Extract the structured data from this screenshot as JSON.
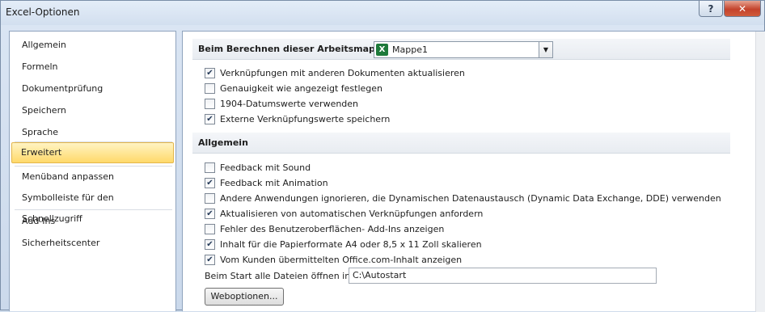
{
  "window": {
    "title": "Excel-Optionen"
  },
  "titlebar_buttons": {
    "help": "?",
    "close": "✕"
  },
  "sidebar": {
    "items": [
      {
        "label": "Allgemein"
      },
      {
        "label": "Formeln"
      },
      {
        "label": "Dokumentprüfung"
      },
      {
        "label": "Speichern"
      },
      {
        "label": "Sprache"
      },
      {
        "label": "Erweitert",
        "selected": true
      },
      {
        "label": "Menüband anpassen"
      },
      {
        "label": "Symbolleiste für den Schnellzugriff"
      },
      {
        "label": "Add-Ins"
      },
      {
        "label": "Sicherheitscenter"
      }
    ]
  },
  "section_calc": {
    "title": "Beim Berechnen dieser Arbeitsmappe:",
    "workbook_select": {
      "value": "Mappe1",
      "icon": "excel-icon"
    },
    "options": [
      {
        "label": "Verknüpfungen mit anderen Dokumenten aktualisieren",
        "checked": true
      },
      {
        "label": "Genauigkeit wie angezeigt festlegen",
        "checked": false
      },
      {
        "label": "1904-Datumswerte verwenden",
        "checked": false
      },
      {
        "label": "Externe Verknüpfungswerte speichern",
        "checked": true
      }
    ]
  },
  "section_general": {
    "title": "Allgemein",
    "options": [
      {
        "label": "Feedback mit Sound",
        "checked": false
      },
      {
        "label": "Feedback mit Animation",
        "checked": true
      },
      {
        "label": "Andere Anwendungen ignorieren, die Dynamischen Datenaustausch (Dynamic Data Exchange, DDE) verwenden",
        "checked": false
      },
      {
        "label": "Aktualisieren von automatischen Verknüpfungen anfordern",
        "checked": true
      },
      {
        "label": "Fehler des Benutzeroberflächen- Add-Ins anzeigen",
        "checked": false
      },
      {
        "label": "Inhalt für die Papierformate A4 oder 8,5 x 11 Zoll skalieren",
        "checked": true
      },
      {
        "label": "Vom Kunden übermittelten Office.com-Inhalt anzeigen",
        "checked": true
      }
    ],
    "startup_folder_label": "Beim Start alle Dateien öffnen in:",
    "startup_folder_value": "C:\\Autostart",
    "web_options_button": "Weboptionen..."
  },
  "check_glyph": "✔",
  "colors": {
    "selected_bg": "#ffd96a",
    "close_button": "#c4432c",
    "excel_green": "#1d7a3a"
  }
}
